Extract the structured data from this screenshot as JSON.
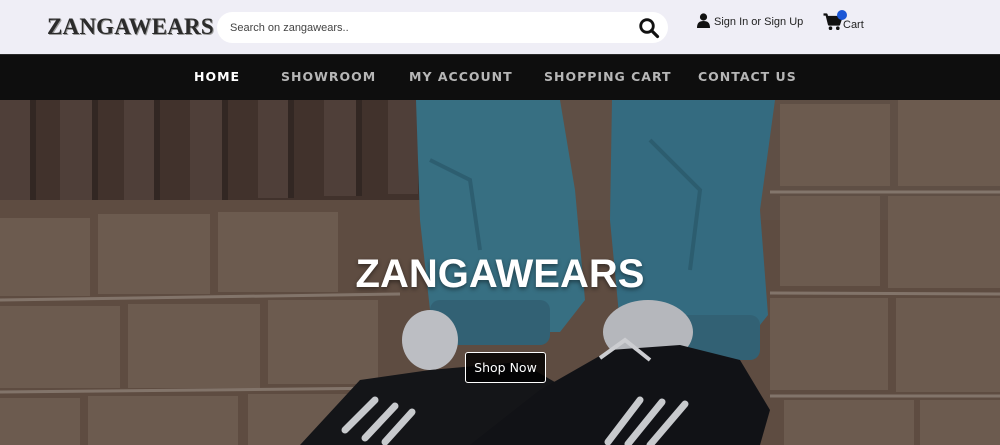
{
  "header": {
    "logo": "ZANGAWEARS",
    "search": {
      "placeholder": "Search on zangawears.."
    },
    "account_link": "Sign In or Sign Up",
    "cart_link": "Cart"
  },
  "nav": {
    "items": [
      {
        "label": "HOME",
        "active": true
      },
      {
        "label": "SHOWROOM",
        "active": false
      },
      {
        "label": "MY ACCOUNT",
        "active": false
      },
      {
        "label": "SHOPPING CART",
        "active": false
      },
      {
        "label": "CONTACT US",
        "active": false
      }
    ]
  },
  "hero": {
    "title": "ZANGAWEARS",
    "cta": "Shop Now"
  },
  "colors": {
    "nav_background": "#0e0e0e",
    "topbar_background": "#efeef6",
    "cart_badge": "#1a56d6"
  },
  "icons": {
    "search": "search-icon",
    "user": "user-icon",
    "cart": "cart-icon"
  }
}
